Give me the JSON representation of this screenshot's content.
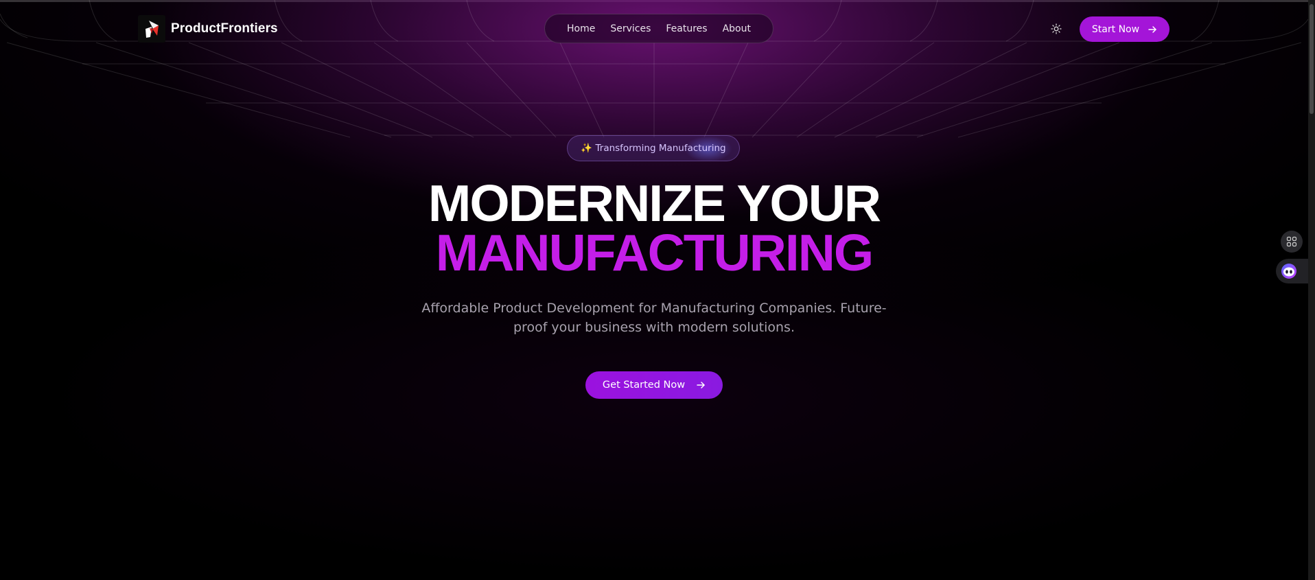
{
  "header": {
    "brand": "ProductFrontiers",
    "nav": [
      "Home",
      "Services",
      "Features",
      "About"
    ],
    "start_button": "Start Now"
  },
  "hero": {
    "badge": "✨ Transforming Manufacturing",
    "title_line1": "MODERNIZE YOUR",
    "title_line2": "MANUFACTURING",
    "subtitle": "Affordable Product Development for Manufacturing Companies. Future-proof your business with modern solutions.",
    "cta": "Get Started Now"
  },
  "icons": {
    "logo": "product-frontiers-logo",
    "theme": "sun-icon",
    "arrow": "arrow-right-icon",
    "side_apps": "apps-grid-icon",
    "side_assistant": "assistant-face-icon"
  },
  "colors": {
    "accent": "#a415d8",
    "title_accent": "#c41ee8",
    "background": "#000000",
    "glow": "#78148a"
  }
}
